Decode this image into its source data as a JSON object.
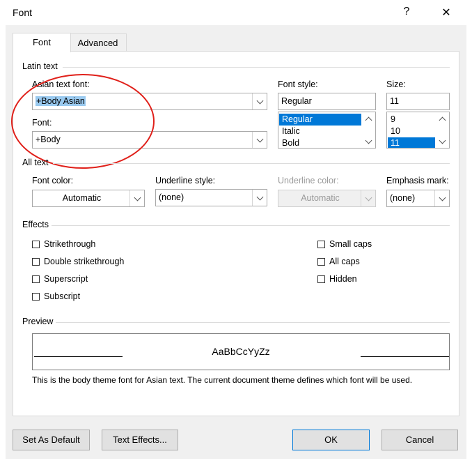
{
  "window": {
    "title": "Font",
    "help_glyph": "?",
    "close_glyph": "✕"
  },
  "tabs": [
    {
      "label": "Font",
      "active": true
    },
    {
      "label": "Advanced",
      "active": false
    }
  ],
  "latin": {
    "section_label": "Latin text",
    "asian_font_label": "Asian text font:",
    "asian_font_value": "+Body Asian",
    "font_label": "Font:",
    "font_value": "+Body",
    "style_label": "Font style:",
    "style_value": "Regular",
    "style_options": [
      "Regular",
      "Italic",
      "Bold"
    ],
    "style_selected": "Regular",
    "size_label": "Size:",
    "size_value": "11",
    "size_options": [
      "9",
      "10",
      "11"
    ],
    "size_selected": "11"
  },
  "all_text": {
    "section_label": "All text",
    "font_color_label": "Font color:",
    "font_color_value": "Automatic",
    "underline_style_label": "Underline style:",
    "underline_style_value": "(none)",
    "underline_color_label": "Underline color:",
    "underline_color_value": "Automatic",
    "emphasis_label": "Emphasis mark:",
    "emphasis_value": "(none)"
  },
  "effects": {
    "section_label": "Effects",
    "left": [
      {
        "label": "Strikethrough",
        "checked": false
      },
      {
        "label": "Double strikethrough",
        "checked": false
      },
      {
        "label": "Superscript",
        "checked": false
      },
      {
        "label": "Subscript",
        "checked": false
      }
    ],
    "right": [
      {
        "label": "Small caps",
        "checked": false
      },
      {
        "label": "All caps",
        "checked": false
      },
      {
        "label": "Hidden",
        "checked": false
      }
    ]
  },
  "preview": {
    "section_label": "Preview",
    "sample": "AaBbCcYyZz",
    "description": "This is the body theme font for Asian text. The current document theme defines which font will be used."
  },
  "buttons": {
    "set_default": "Set As Default",
    "text_effects": "Text Effects...",
    "ok": "OK",
    "cancel": "Cancel"
  },
  "colors": {
    "accent": "#0078d7",
    "annotation": "#e0201a",
    "selection_highlight": "#99c9ef"
  }
}
